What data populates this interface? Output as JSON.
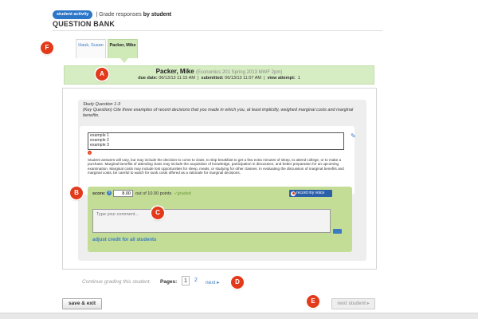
{
  "header": {
    "badge": "student activity",
    "breadcrumb_prefix": "| Grade responses ",
    "breadcrumb_bold": "by student",
    "page_title": "QUESTION BANK"
  },
  "tabs": [
    {
      "label": "Hauk, Susan",
      "active": false
    },
    {
      "label": "Packer, Mike",
      "active": true
    }
  ],
  "student": {
    "name": "Packer, Mike",
    "course": "(Economics 201 Spring 2013 MWF 2pm)",
    "due_label": "due date:",
    "due_value": "06/13/13 11:15 AM",
    "submitted_label": "submitted:",
    "submitted_value": "06/13/13 11:07 AM",
    "attempt_label": "view attempt:",
    "attempt_value": "1"
  },
  "question": {
    "title": "Study Question 1-3",
    "text": "(Key Question) Cite three examples of recent decisions that you made in which you, at least implicitly, weighed marginal costs and marginal benefits.",
    "answer_lines": [
      "example 1",
      "example 2",
      "example 3"
    ],
    "rationale": "Student answers will vary, but may include the decision to come to class, to skip breakfast to get a few extra minutes of sleep, to attend college, or to make a purchase. Marginal benefits of attending class may include the acquisition of knowledge, participation in discussion, and better preparation for an upcoming examination. Marginal costs may include lost opportunities for sleep, meals, or studying for other classes. In evaluating the discussion of marginal benefits and marginal costs, be careful to watch for sunk costs offered as a rationale for marginal decisions."
  },
  "grading": {
    "score_label": "score:",
    "score_value": "8.00",
    "out_of": "out of 10.00 points",
    "graded": "✓graded",
    "record_voice": "record my voice",
    "comment_placeholder": "Type your comment...",
    "adjust_link": "adjust credit for all students"
  },
  "pagination": {
    "continue_text": "Continue grading this student.",
    "pages_label": "Pages:",
    "pages": [
      "1",
      "2"
    ],
    "next": "next ▸"
  },
  "footer": {
    "save_exit": "save & exit",
    "next_student": "next student ▸"
  },
  "callouts": {
    "a": "A",
    "b": "B",
    "c": "C",
    "d": "D",
    "e": "E",
    "f": "F"
  },
  "colors": {
    "accent_blue": "#2c76c8",
    "callout_red": "#e33a1c",
    "banner_green": "#d6ecc3",
    "panel_green": "#c4dd96"
  }
}
